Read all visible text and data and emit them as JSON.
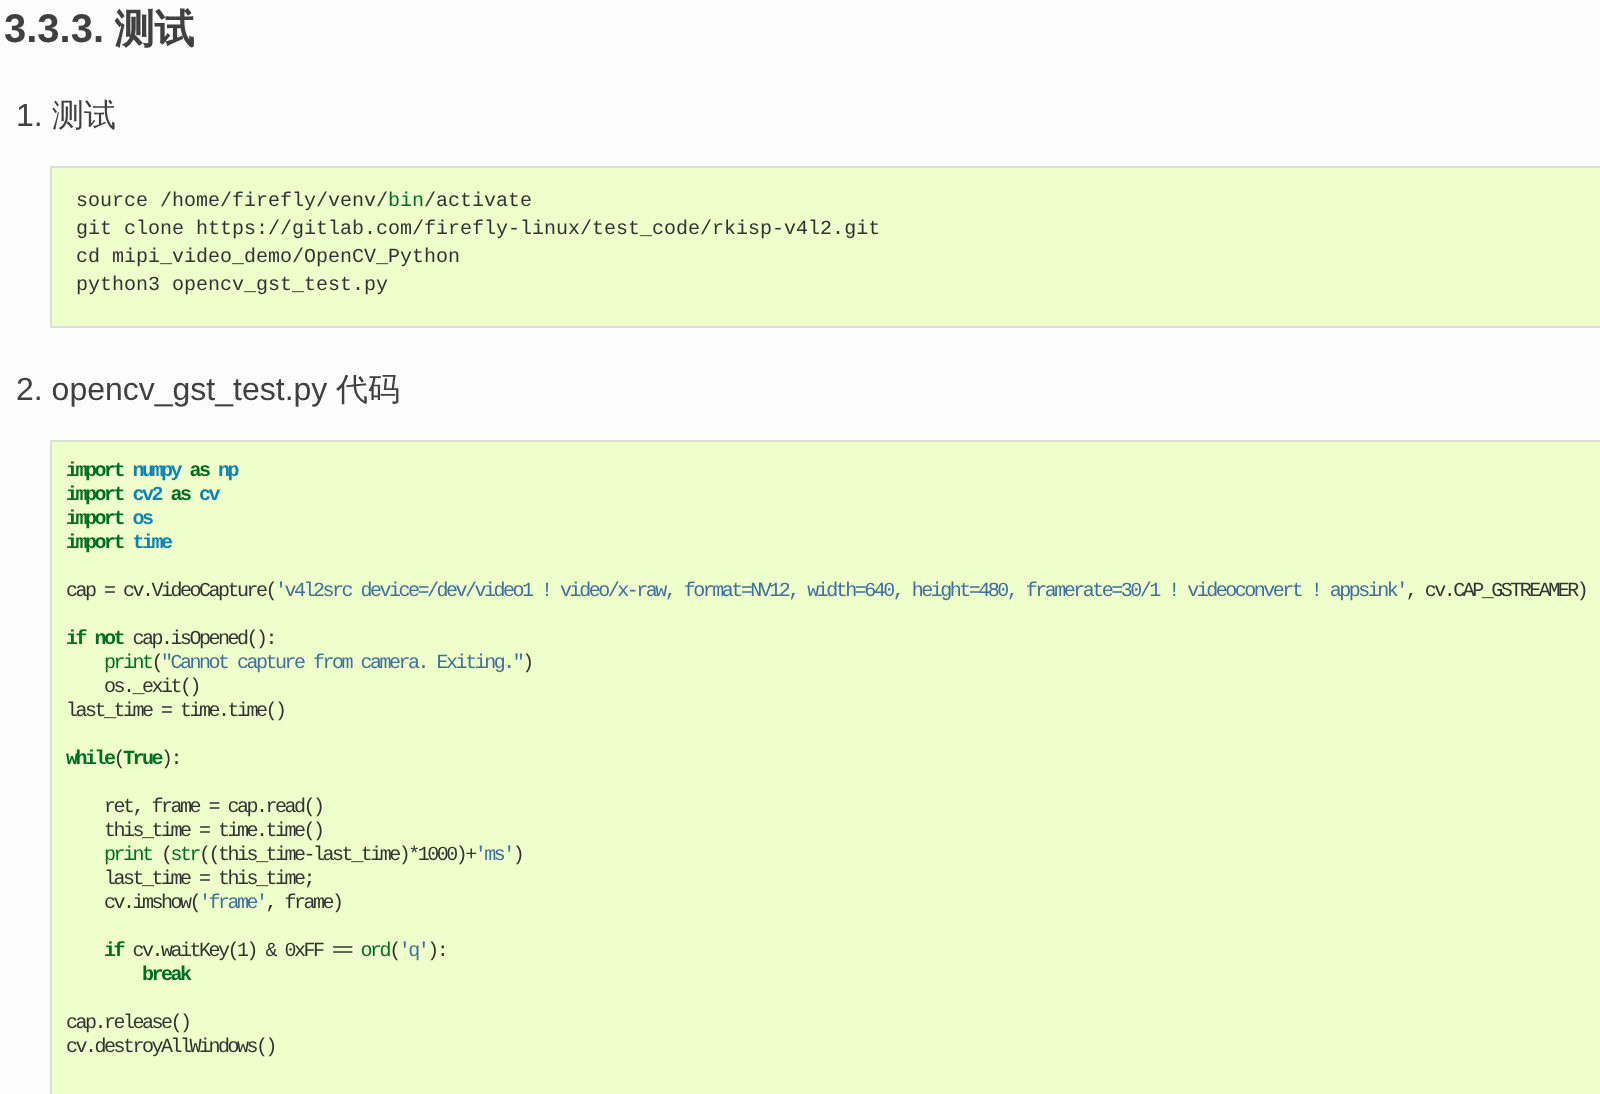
{
  "heading": "3.3.3. 测试",
  "sections": [
    {
      "title": "1. 测试",
      "code": {
        "lines": [
          {
            "tokens": [
              {
                "text": "source /home/firefly/venv/",
                "kind": "plain"
              },
              {
                "text": "bin",
                "kind": "builtin"
              },
              {
                "text": "/activate",
                "kind": "plain"
              }
            ]
          },
          {
            "tokens": [
              {
                "text": "git clone https://gitlab.com/firefly-linux/test_code/rkisp-v4l2.git",
                "kind": "plain"
              }
            ]
          },
          {
            "tokens": [
              {
                "text": "cd mipi_video_demo/OpenCV_Python",
                "kind": "plain"
              }
            ]
          },
          {
            "tokens": [
              {
                "text": "python3 opencv_gst_test.py",
                "kind": "plain"
              }
            ]
          }
        ]
      }
    },
    {
      "title": "2. opencv_gst_test.py 代码",
      "code": {
        "lines": [
          {
            "tokens": [
              {
                "text": "import",
                "kind": "kw"
              },
              {
                "text": " numpy",
                "kind": "ns"
              },
              {
                "text": " as ",
                "kind": "kw"
              },
              {
                "text": "np",
                "kind": "ns"
              }
            ]
          },
          {
            "tokens": [
              {
                "text": "import",
                "kind": "kw"
              },
              {
                "text": " cv2",
                "kind": "ns"
              },
              {
                "text": " as ",
                "kind": "kw"
              },
              {
                "text": "cv",
                "kind": "ns"
              }
            ]
          },
          {
            "tokens": [
              {
                "text": "import",
                "kind": "kw"
              },
              {
                "text": " os",
                "kind": "ns"
              }
            ]
          },
          {
            "tokens": [
              {
                "text": "import",
                "kind": "kw"
              },
              {
                "text": " time",
                "kind": "ns"
              }
            ]
          },
          {
            "blank_before": true,
            "tokens": [
              {
                "text": "cap = cv.VideoCapture(",
                "kind": "plain"
              },
              {
                "text": "'v4l2src device=/dev/video1 ! video/x-raw, format=NV12, width=640, height=480, framerate=30/1 ! videoconvert ! appsink'",
                "kind": "str"
              },
              {
                "text": ", cv.CAP_GSTREAMER)",
                "kind": "plain"
              }
            ]
          },
          {
            "blank_before": true,
            "tokens": [
              {
                "text": "if not",
                "kind": "kw"
              },
              {
                "text": " cap.isOpened():",
                "kind": "plain"
              }
            ]
          },
          {
            "tokens": [
              {
                "text": "    print",
                "kind": "builtin"
              },
              {
                "text": "(",
                "kind": "plain"
              },
              {
                "text": "\"Cannot capture from camera. Exiting.\"",
                "kind": "str"
              },
              {
                "text": ")",
                "kind": "plain"
              }
            ]
          },
          {
            "tokens": [
              {
                "text": "    os._exit()",
                "kind": "plain"
              }
            ]
          },
          {
            "tokens": [
              {
                "text": "last_time = time.time()",
                "kind": "plain"
              }
            ]
          },
          {
            "blank_before": true,
            "tokens": [
              {
                "text": "while",
                "kind": "kw"
              },
              {
                "text": "(",
                "kind": "plain"
              },
              {
                "text": "True",
                "kind": "kw"
              },
              {
                "text": "):",
                "kind": "plain"
              }
            ]
          },
          {
            "blank_before": true,
            "tokens": [
              {
                "text": "    ret, frame = cap.read()",
                "kind": "plain"
              }
            ]
          },
          {
            "tokens": [
              {
                "text": "    this_time = time.time()",
                "kind": "plain"
              }
            ]
          },
          {
            "tokens": [
              {
                "text": "    print",
                "kind": "builtin"
              },
              {
                "text": " (",
                "kind": "plain"
              },
              {
                "text": "str",
                "kind": "builtin"
              },
              {
                "text": "((this_time-last_time)*1000)+",
                "kind": "plain"
              },
              {
                "text": "'ms'",
                "kind": "str"
              },
              {
                "text": ")",
                "kind": "plain"
              }
            ]
          },
          {
            "tokens": [
              {
                "text": "    last_time = this_time;",
                "kind": "plain"
              }
            ]
          },
          {
            "tokens": [
              {
                "text": "    cv.imshow(",
                "kind": "plain"
              },
              {
                "text": "'frame'",
                "kind": "str"
              },
              {
                "text": ", frame)",
                "kind": "plain"
              }
            ]
          },
          {
            "blank_before": true,
            "tokens": [
              {
                "text": "    if",
                "kind": "kw"
              },
              {
                "text": " cv.waitKey(1) & 0xFF == ",
                "kind": "plain"
              },
              {
                "text": "ord",
                "kind": "builtin"
              },
              {
                "text": "(",
                "kind": "plain"
              },
              {
                "text": "'q'",
                "kind": "str"
              },
              {
                "text": "):",
                "kind": "plain"
              }
            ]
          },
          {
            "tokens": [
              {
                "text": "        break",
                "kind": "kw"
              }
            ]
          },
          {
            "blank_before": true,
            "tokens": [
              {
                "text": "cap.release()",
                "kind": "plain"
              }
            ]
          },
          {
            "tokens": [
              {
                "text": "cv.destroyAllWindows()",
                "kind": "plain"
              }
            ]
          }
        ]
      }
    }
  ]
}
